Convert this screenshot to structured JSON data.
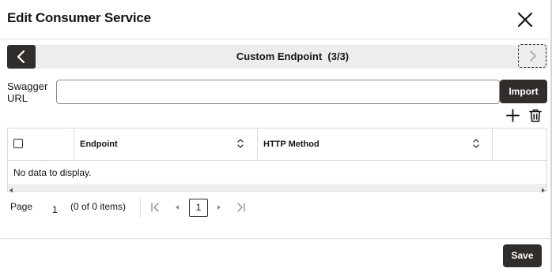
{
  "dialog": {
    "title": "Edit Consumer Service"
  },
  "train": {
    "label": "Custom Endpoint  (3/3)"
  },
  "swagger": {
    "label": "Swagger URL",
    "value": "",
    "import_label": "Import"
  },
  "table": {
    "columns": [
      "Endpoint",
      "HTTP Method"
    ],
    "empty_message": "No data to display."
  },
  "pagination": {
    "page_label": "Page",
    "page_value": "1",
    "items_text": "(0 of 0 items)",
    "current_page": "1"
  },
  "footer": {
    "save_label": "Save"
  },
  "colors": {
    "button_dark": "#312d2a",
    "train_bg": "#eeedeb",
    "border": "#dedbd8"
  }
}
